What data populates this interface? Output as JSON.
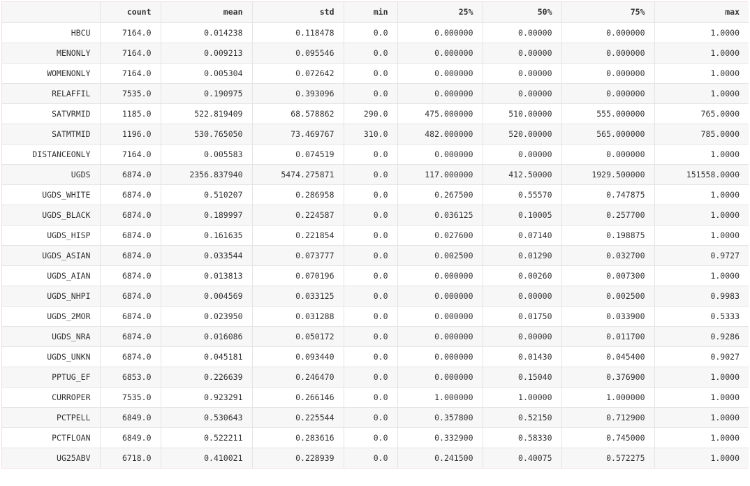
{
  "table": {
    "index_header": "",
    "columns": [
      "count",
      "mean",
      "std",
      "min",
      "25%",
      "50%",
      "75%",
      "max"
    ],
    "rows": [
      {
        "name": "HBCU",
        "values": [
          "7164.0",
          "0.014238",
          "0.118478",
          "0.0",
          "0.000000",
          "0.00000",
          "0.000000",
          "1.0000"
        ]
      },
      {
        "name": "MENONLY",
        "values": [
          "7164.0",
          "0.009213",
          "0.095546",
          "0.0",
          "0.000000",
          "0.00000",
          "0.000000",
          "1.0000"
        ]
      },
      {
        "name": "WOMENONLY",
        "values": [
          "7164.0",
          "0.005304",
          "0.072642",
          "0.0",
          "0.000000",
          "0.00000",
          "0.000000",
          "1.0000"
        ]
      },
      {
        "name": "RELAFFIL",
        "values": [
          "7535.0",
          "0.190975",
          "0.393096",
          "0.0",
          "0.000000",
          "0.00000",
          "0.000000",
          "1.0000"
        ]
      },
      {
        "name": "SATVRMID",
        "values": [
          "1185.0",
          "522.819409",
          "68.578862",
          "290.0",
          "475.000000",
          "510.00000",
          "555.000000",
          "765.0000"
        ]
      },
      {
        "name": "SATMTMID",
        "values": [
          "1196.0",
          "530.765050",
          "73.469767",
          "310.0",
          "482.000000",
          "520.00000",
          "565.000000",
          "785.0000"
        ]
      },
      {
        "name": "DISTANCEONLY",
        "values": [
          "7164.0",
          "0.005583",
          "0.074519",
          "0.0",
          "0.000000",
          "0.00000",
          "0.000000",
          "1.0000"
        ]
      },
      {
        "name": "UGDS",
        "values": [
          "6874.0",
          "2356.837940",
          "5474.275871",
          "0.0",
          "117.000000",
          "412.50000",
          "1929.500000",
          "151558.0000"
        ]
      },
      {
        "name": "UGDS_WHITE",
        "values": [
          "6874.0",
          "0.510207",
          "0.286958",
          "0.0",
          "0.267500",
          "0.55570",
          "0.747875",
          "1.0000"
        ]
      },
      {
        "name": "UGDS_BLACK",
        "values": [
          "6874.0",
          "0.189997",
          "0.224587",
          "0.0",
          "0.036125",
          "0.10005",
          "0.257700",
          "1.0000"
        ]
      },
      {
        "name": "UGDS_HISP",
        "values": [
          "6874.0",
          "0.161635",
          "0.221854",
          "0.0",
          "0.027600",
          "0.07140",
          "0.198875",
          "1.0000"
        ]
      },
      {
        "name": "UGDS_ASIAN",
        "values": [
          "6874.0",
          "0.033544",
          "0.073777",
          "0.0",
          "0.002500",
          "0.01290",
          "0.032700",
          "0.9727"
        ]
      },
      {
        "name": "UGDS_AIAN",
        "values": [
          "6874.0",
          "0.013813",
          "0.070196",
          "0.0",
          "0.000000",
          "0.00260",
          "0.007300",
          "1.0000"
        ]
      },
      {
        "name": "UGDS_NHPI",
        "values": [
          "6874.0",
          "0.004569",
          "0.033125",
          "0.0",
          "0.000000",
          "0.00000",
          "0.002500",
          "0.9983"
        ]
      },
      {
        "name": "UGDS_2MOR",
        "values": [
          "6874.0",
          "0.023950",
          "0.031288",
          "0.0",
          "0.000000",
          "0.01750",
          "0.033900",
          "0.5333"
        ]
      },
      {
        "name": "UGDS_NRA",
        "values": [
          "6874.0",
          "0.016086",
          "0.050172",
          "0.0",
          "0.000000",
          "0.00000",
          "0.011700",
          "0.9286"
        ]
      },
      {
        "name": "UGDS_UNKN",
        "values": [
          "6874.0",
          "0.045181",
          "0.093440",
          "0.0",
          "0.000000",
          "0.01430",
          "0.045400",
          "0.9027"
        ]
      },
      {
        "name": "PPTUG_EF",
        "values": [
          "6853.0",
          "0.226639",
          "0.246470",
          "0.0",
          "0.000000",
          "0.15040",
          "0.376900",
          "1.0000"
        ]
      },
      {
        "name": "CURROPER",
        "values": [
          "7535.0",
          "0.923291",
          "0.266146",
          "0.0",
          "1.000000",
          "1.00000",
          "1.000000",
          "1.0000"
        ]
      },
      {
        "name": "PCTPELL",
        "values": [
          "6849.0",
          "0.530643",
          "0.225544",
          "0.0",
          "0.357800",
          "0.52150",
          "0.712900",
          "1.0000"
        ]
      },
      {
        "name": "PCTFLOAN",
        "values": [
          "6849.0",
          "0.522211",
          "0.283616",
          "0.0",
          "0.332900",
          "0.58330",
          "0.745000",
          "1.0000"
        ]
      },
      {
        "name": "UG25ABV",
        "values": [
          "6718.0",
          "0.410021",
          "0.228939",
          "0.0",
          "0.241500",
          "0.40075",
          "0.572275",
          "1.0000"
        ]
      }
    ]
  }
}
